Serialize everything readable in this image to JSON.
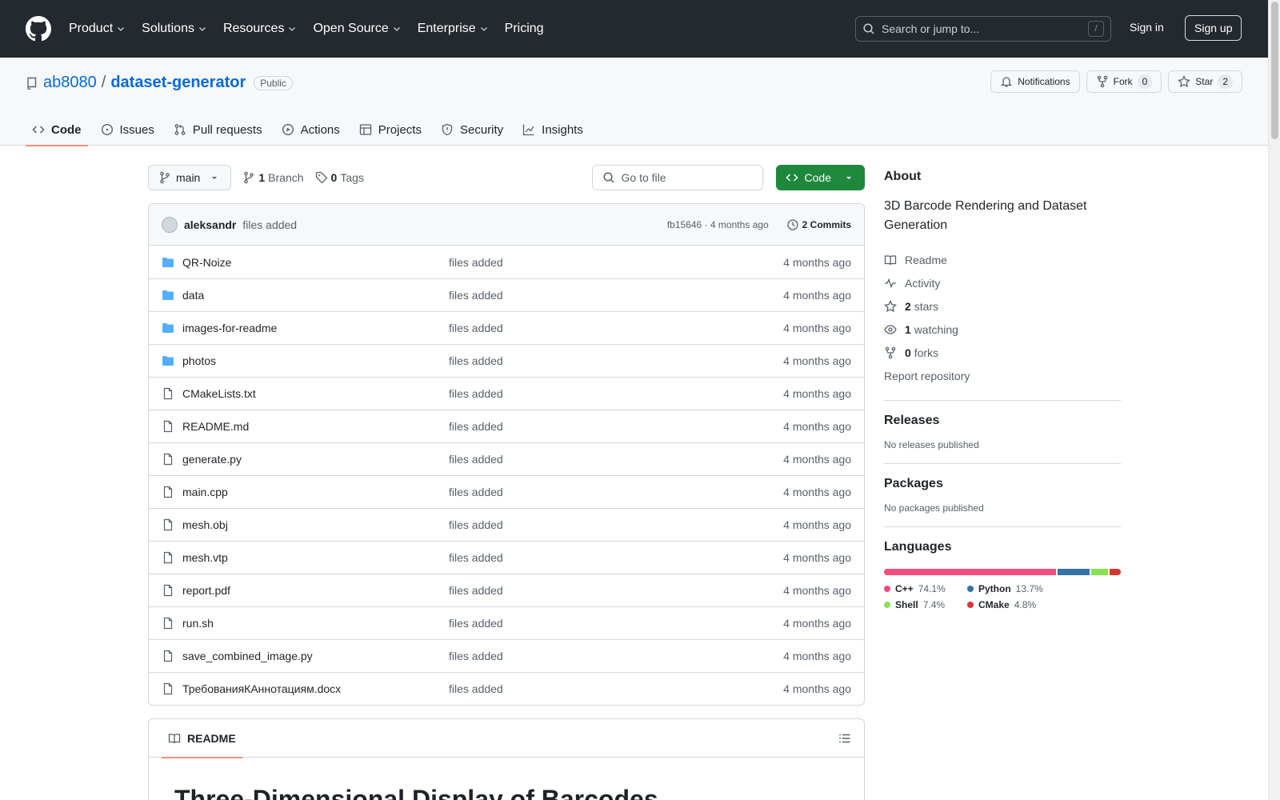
{
  "header": {
    "nav": [
      {
        "label": "Product",
        "dropdown": true
      },
      {
        "label": "Solutions",
        "dropdown": true
      },
      {
        "label": "Resources",
        "dropdown": true
      },
      {
        "label": "Open Source",
        "dropdown": true
      },
      {
        "label": "Enterprise",
        "dropdown": true
      },
      {
        "label": "Pricing",
        "dropdown": false
      }
    ],
    "search_placeholder": "Search or jump to...",
    "search_shortcut": "/",
    "signin": "Sign in",
    "signup": "Sign up"
  },
  "repo": {
    "owner": "ab8080",
    "separator": "/",
    "name": "dataset-generator",
    "visibility": "Public",
    "notifications_label": "Notifications",
    "fork_label": "Fork",
    "fork_count": "0",
    "star_label": "Star",
    "star_count": "2"
  },
  "tabs": [
    {
      "label": "Code",
      "icon": "code-icon",
      "active": true
    },
    {
      "label": "Issues",
      "icon": "issue-icon",
      "active": false
    },
    {
      "label": "Pull requests",
      "icon": "pull-request-icon",
      "active": false
    },
    {
      "label": "Actions",
      "icon": "play-icon",
      "active": false
    },
    {
      "label": "Projects",
      "icon": "table-icon",
      "active": false
    },
    {
      "label": "Security",
      "icon": "shield-icon",
      "active": false
    },
    {
      "label": "Insights",
      "icon": "graph-icon",
      "active": false
    }
  ],
  "toolbar": {
    "branch": "main",
    "branch_count": "1",
    "branch_label": "Branch",
    "tag_count": "0",
    "tag_label": "Tags",
    "goto_placeholder": "Go to file",
    "code_label": "Code"
  },
  "commit": {
    "author": "aleksandr",
    "message": "files added",
    "hash": "fb15646",
    "dot": "·",
    "age": "4 months ago",
    "commits_label": "2 Commits"
  },
  "files": [
    {
      "name": "QR-Noize",
      "type": "dir",
      "message": "files added",
      "age": "4 months ago"
    },
    {
      "name": "data",
      "type": "dir",
      "message": "files added",
      "age": "4 months ago"
    },
    {
      "name": "images-for-readme",
      "type": "dir",
      "message": "files added",
      "age": "4 months ago"
    },
    {
      "name": "photos",
      "type": "dir",
      "message": "files added",
      "age": "4 months ago"
    },
    {
      "name": "CMakeLists.txt",
      "type": "file",
      "message": "files added",
      "age": "4 months ago"
    },
    {
      "name": "README.md",
      "type": "file",
      "message": "files added",
      "age": "4 months ago"
    },
    {
      "name": "generate.py",
      "type": "file",
      "message": "files added",
      "age": "4 months ago"
    },
    {
      "name": "main.cpp",
      "type": "file",
      "message": "files added",
      "age": "4 months ago"
    },
    {
      "name": "mesh.obj",
      "type": "file",
      "message": "files added",
      "age": "4 months ago"
    },
    {
      "name": "mesh.vtp",
      "type": "file",
      "message": "files added",
      "age": "4 months ago"
    },
    {
      "name": "report.pdf",
      "type": "file",
      "message": "files added",
      "age": "4 months ago"
    },
    {
      "name": "run.sh",
      "type": "file",
      "message": "files added",
      "age": "4 months ago"
    },
    {
      "name": "save_combined_image.py",
      "type": "file",
      "message": "files added",
      "age": "4 months ago"
    },
    {
      "name": "ТребованияКАннотациям.docx",
      "type": "file",
      "message": "files added",
      "age": "4 months ago"
    }
  ],
  "readme": {
    "tab_label": "README",
    "heading": "Three-Dimensional Display of Barcodes"
  },
  "about": {
    "title": "About",
    "description": "3D Barcode Rendering and Dataset Generation",
    "readme": "Readme",
    "activity": "Activity",
    "stars_count": "2",
    "stars_label": "stars",
    "watching_count": "1",
    "watching_label": "watching",
    "forks_count": "0",
    "forks_label": "forks",
    "report": "Report repository"
  },
  "releases": {
    "title": "Releases",
    "empty": "No releases published"
  },
  "packages": {
    "title": "Packages",
    "empty": "No packages published"
  },
  "languages": {
    "title": "Languages",
    "items": [
      {
        "name": "C++",
        "percent": "74.1%",
        "value": 74.1,
        "color": "#f34b7d"
      },
      {
        "name": "Python",
        "percent": "13.7%",
        "value": 13.7,
        "color": "#3572A5"
      },
      {
        "name": "Shell",
        "percent": "7.4%",
        "value": 7.4,
        "color": "#89e051"
      },
      {
        "name": "CMake",
        "percent": "4.8%",
        "value": 4.8,
        "color": "#DA3434"
      }
    ]
  }
}
